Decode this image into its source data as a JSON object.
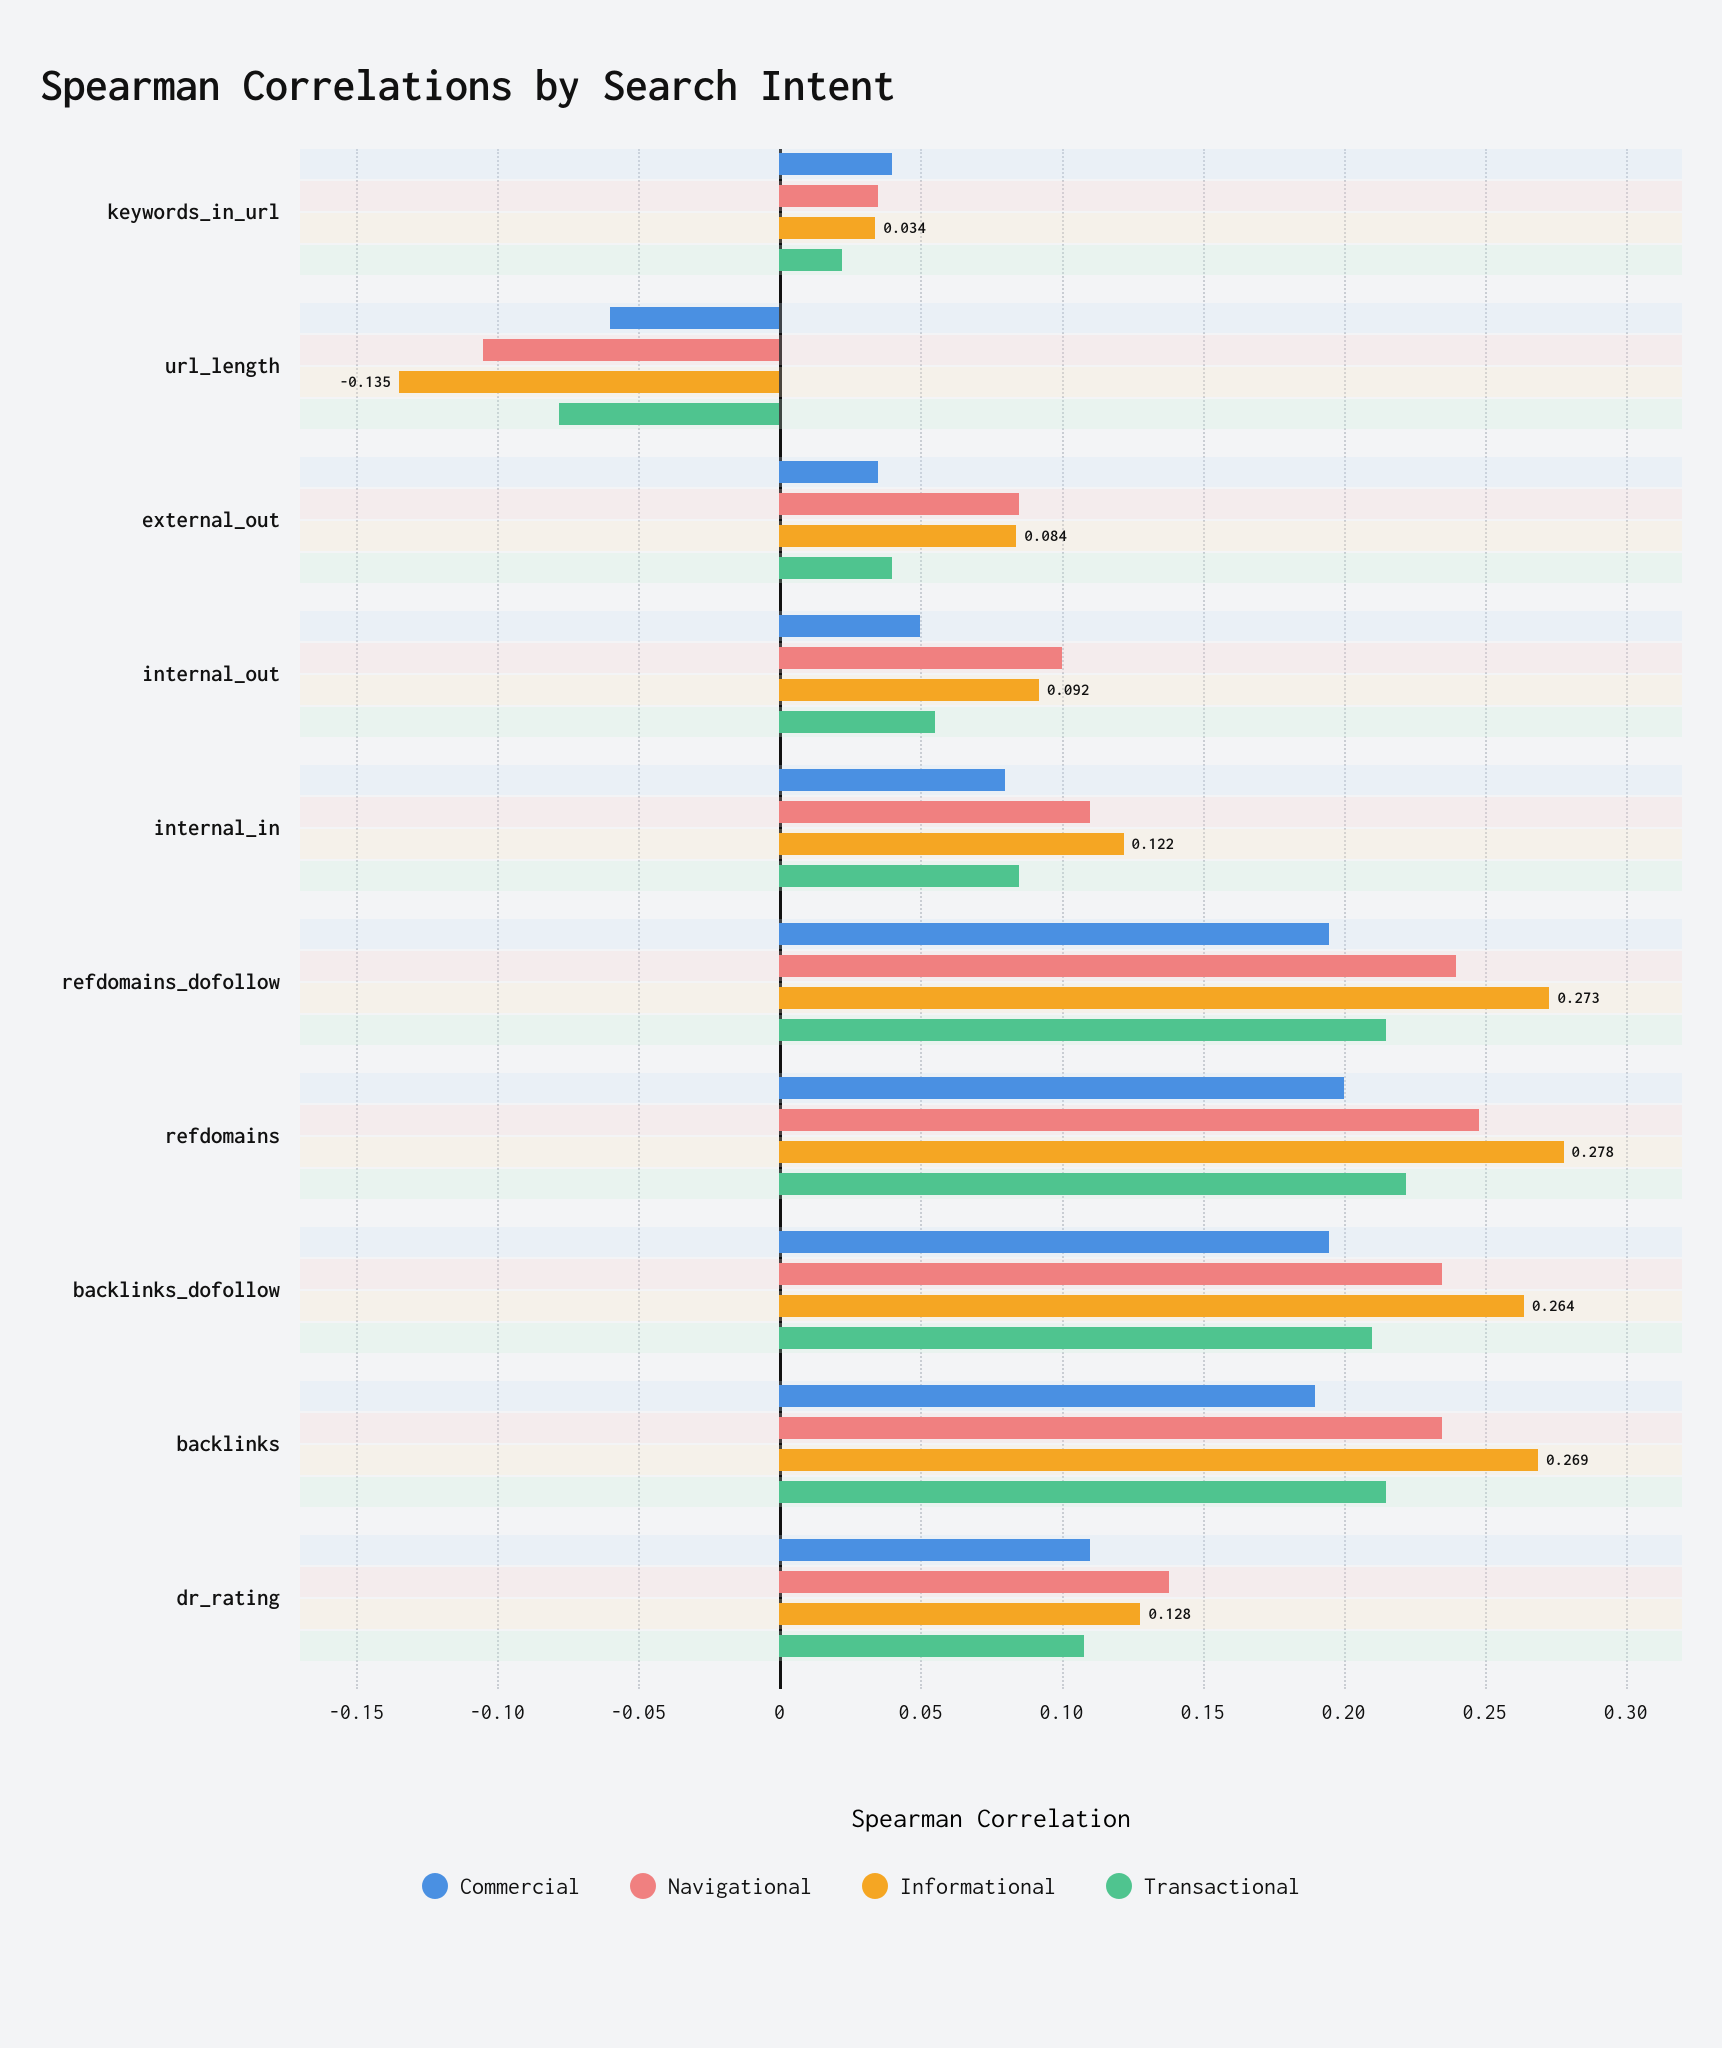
{
  "chart_data": {
    "type": "bar",
    "orientation": "horizontal",
    "title": "Spearman Correlations by Search Intent",
    "xlabel": "Spearman Correlation",
    "ylabel": "",
    "xlim": [
      -0.17,
      0.32
    ],
    "x_ticks": [
      -0.15,
      -0.1,
      -0.05,
      0,
      0.05,
      0.1,
      0.15,
      0.2,
      0.25,
      0.3
    ],
    "x_tick_labels": [
      "-0.15",
      "-0.10",
      "-0.05",
      "0",
      "0.05",
      "0.10",
      "0.15",
      "0.20",
      "0.25",
      "0.30"
    ],
    "categories": [
      "keywords_in_url",
      "url_length",
      "external_out",
      "internal_out",
      "internal_in",
      "refdomains_\ndofollow",
      "refdomains",
      "backlinks_\ndofollow",
      "backlinks",
      "dr_rating"
    ],
    "series": [
      {
        "name": "Commercial",
        "color": "#4a90e2",
        "bg": "#cfe3f7",
        "values": [
          0.04,
          -0.06,
          0.035,
          0.05,
          0.08,
          0.195,
          0.2,
          0.195,
          0.19,
          0.11
        ]
      },
      {
        "name": "Navigational",
        "color": "#f08080",
        "bg": "#f9d4d4",
        "values": [
          0.035,
          -0.105,
          0.085,
          0.1,
          0.11,
          0.24,
          0.248,
          0.235,
          0.235,
          0.138
        ]
      },
      {
        "name": "Informational",
        "color": "#f5a623",
        "bg": "#fbe6c6",
        "values": [
          0.034,
          -0.135,
          0.084,
          0.092,
          0.122,
          0.273,
          0.278,
          0.264,
          0.269,
          0.128
        ]
      },
      {
        "name": "Transactional",
        "color": "#4fc48f",
        "bg": "#cdeedd",
        "values": [
          0.022,
          -0.078,
          0.04,
          0.055,
          0.085,
          0.215,
          0.222,
          0.21,
          0.215,
          0.108
        ]
      }
    ],
    "labeled_series_index": 2,
    "value_labels": [
      "0.034",
      "-0.135",
      "0.084",
      "0.092",
      "0.122",
      "0.273",
      "0.278",
      "0.264",
      "0.269",
      "0.128"
    ],
    "legend": [
      "Commercial",
      "Navigational",
      "Informational",
      "Transactional"
    ]
  }
}
